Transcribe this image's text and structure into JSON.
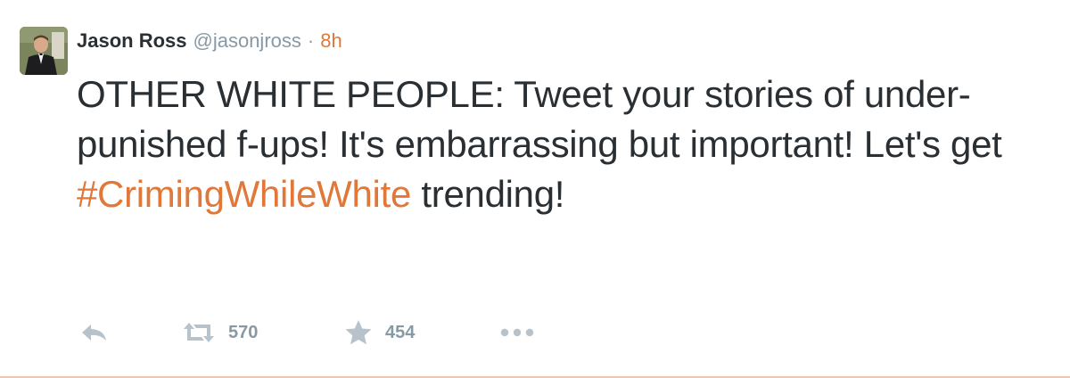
{
  "tweet": {
    "author": {
      "name": "Jason Ross",
      "handle": "@jasonjross"
    },
    "separator": "·",
    "time": "8h",
    "text_before": "OTHER WHITE PEOPLE: Tweet your stories of under-punished f-ups! It's embarrassing but important! Let's get ",
    "hashtag": "#CrimingWhileWhite",
    "text_after": " trending!",
    "actions": {
      "retweet_count": "570",
      "favorite_count": "454"
    }
  },
  "colors": {
    "accent": "#e0783a",
    "text": "#292f33",
    "muted": "#8899a6",
    "icon": "#b8c2cb"
  },
  "icons": [
    "reply-icon",
    "retweet-icon",
    "favorite-icon",
    "more-icon"
  ]
}
